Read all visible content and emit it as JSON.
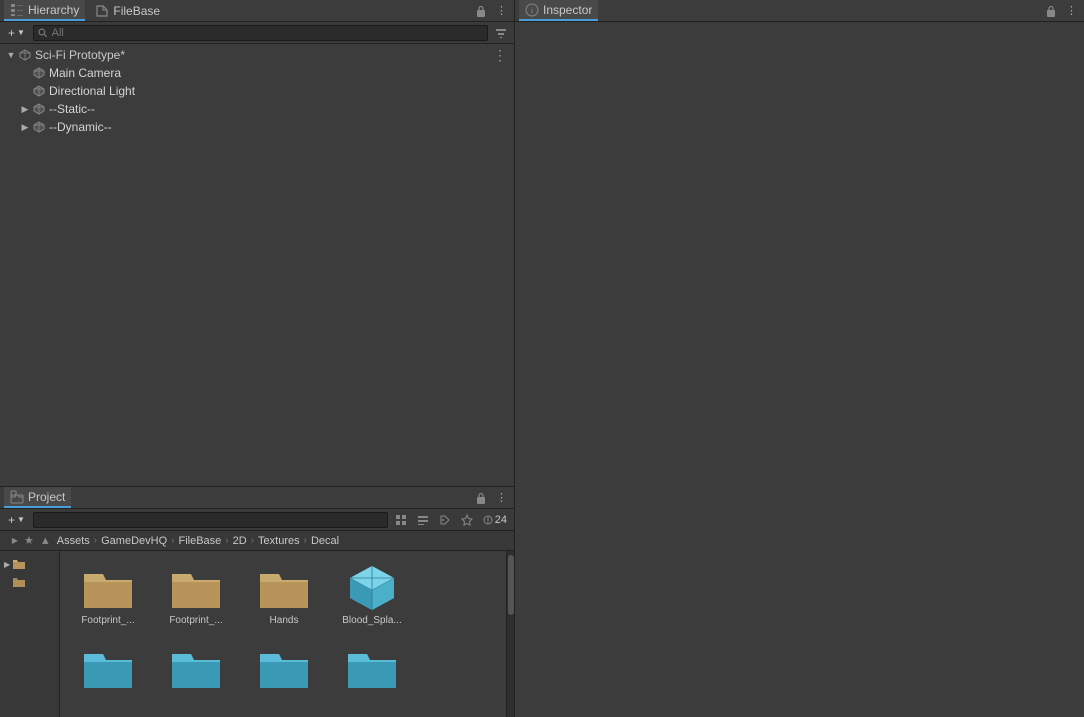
{
  "hierarchy": {
    "tab_label": "Hierarchy",
    "filebases_tab": "FileBase",
    "add_button": "+",
    "add_arrow": "▼",
    "search_placeholder": "All",
    "scene_root": "Sci-Fi Prototype*",
    "tree_items": [
      {
        "id": "main-camera",
        "label": "Main Camera",
        "indent": 1,
        "has_arrow": false,
        "icon": "cube"
      },
      {
        "id": "directional-light",
        "label": "Directional Light",
        "indent": 1,
        "has_arrow": false,
        "icon": "cube"
      },
      {
        "id": "static",
        "label": "--Static--",
        "indent": 1,
        "has_arrow": true,
        "arrow_dir": "right",
        "icon": "cube"
      },
      {
        "id": "dynamic",
        "label": "--Dynamic--",
        "indent": 1,
        "has_arrow": true,
        "arrow_dir": "right",
        "icon": "cube"
      }
    ]
  },
  "project": {
    "tab_label": "Project",
    "add_button": "+",
    "add_arrow": "▼",
    "breadcrumbs": [
      "Assets",
      "GameDevHQ",
      "FileBase",
      "2D",
      "Textures",
      "Decal"
    ],
    "file_count": "24",
    "files": [
      {
        "id": "footprint1",
        "label": "Footprint_...",
        "type": "folder"
      },
      {
        "id": "footprint2",
        "label": "Footprint_...",
        "type": "folder"
      },
      {
        "id": "hands",
        "label": "Hands",
        "type": "folder"
      },
      {
        "id": "blood_splash",
        "label": "Blood_Spla...",
        "type": "cube"
      },
      {
        "id": "folder5",
        "label": "",
        "type": "folder"
      },
      {
        "id": "folder6",
        "label": "",
        "type": "folder"
      },
      {
        "id": "folder7",
        "label": "",
        "type": "folder"
      },
      {
        "id": "folder8",
        "label": "",
        "type": "folder"
      }
    ]
  },
  "inspector": {
    "tab_label": "Inspector",
    "icon": "i"
  },
  "icons": {
    "cube_color": "#5bbcd9",
    "folder_color": "#c8a96e",
    "folder_dark": "#b8945a"
  }
}
